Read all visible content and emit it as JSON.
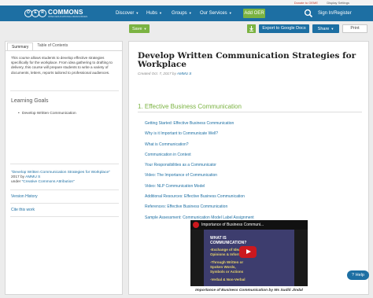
{
  "top_strip": {
    "donate": "Donate to OEME",
    "display": "Display Settings"
  },
  "header": {
    "logo_letters": [
      "O",
      "E",
      "R"
    ],
    "logo_title": "COMMONS",
    "logo_sub": "OPEN EDUCATIONAL RESOURCES",
    "nav": [
      "Discover",
      "Hubs",
      "Groups",
      "Our Services"
    ],
    "add_oer": "Add OER",
    "signin": "Sign In/Register"
  },
  "toolbar": {
    "save": "Save",
    "export": "Export to Google Docs",
    "share": "Share",
    "print": "Print"
  },
  "sidebar": {
    "tabs": [
      "Summary",
      "Table of Contents"
    ],
    "summary": "This course allows students to develop effective strategies specifically for the workplace. From idea gathering to drafting to delivery, this course will prepare students to write a variety of documents, letters, reports tailored to professional audiences.",
    "goals_title": "Learning Goals",
    "goals": [
      "Develop Written Communication"
    ],
    "cite_title": "\"Develop Written Communication Strategies for Workplace\"",
    "cite_mid": " 2017 by ",
    "cite_author": "AMMU S",
    "cite_under": " under ",
    "cite_license": "\"Creative Commons Attribution\"",
    "version_history": "Version History",
    "cite_this_work": "Cite this work"
  },
  "main": {
    "title": "Develop Written Communication Strategies for Workplace",
    "byline_prefix": "Created ",
    "byline_date": "Oct. 7, 2017",
    "byline_by": " by ",
    "byline_author": "AMMU S",
    "section_title": "1. Effective Business Communication",
    "links": [
      "Getting Started: Effective Business Communication",
      "Why is it Important to Communicate Well?",
      "What is Communication?",
      "Communication in Context",
      "Your Responsibilities as a Communicator",
      "Video: The Importance of Communication",
      "Video: NLP Communication Model",
      "Additional Resources: Effective Business Communication",
      "References: Effective Business Communication",
      "Sample Assessment: Communication Model Label Assignment"
    ],
    "video": {
      "title": "Importance of Business Communi...",
      "slide_lines": [
        "WHAT IS",
        "COMMUNICATION?",
        "-Exchange of Ideas,",
        "Opinions & Information",
        "-Through Written or",
        "Spoken Words,",
        "Symbols or Actions",
        "-Verbal & Non-Verbal"
      ]
    },
    "caption": "Importance of Business Communication by Ms Suditi Jindal"
  },
  "help": "Help"
}
